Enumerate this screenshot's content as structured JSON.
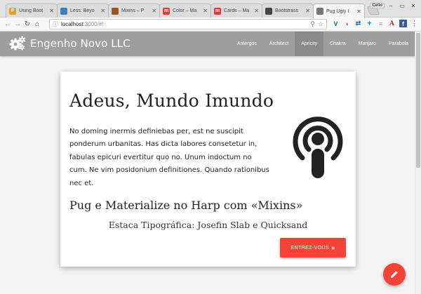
{
  "browser": {
    "tabs": [
      {
        "title": "Using Boot",
        "fav": "P",
        "fav_color": "#f39c12"
      },
      {
        "title": "Less: Beyo",
        "fav": "",
        "fav_color": "#3d7fbf"
      },
      {
        "title": "Mixins – P",
        "fav": "",
        "fav_color": "#a0522d"
      },
      {
        "title": "Color – Ma",
        "fav": "m",
        "fav_color": "#e53935"
      },
      {
        "title": "Cards – Ma",
        "fav": "m",
        "fav_color": "#e53935"
      },
      {
        "title": "Bootstrass",
        "fav": "",
        "fav_color": "#444444"
      },
      {
        "title": "Pug Ugly I",
        "fav": "",
        "fav_color": "#777777"
      }
    ],
    "profile_label": "Celio",
    "address": {
      "host": "localhost",
      "path": ":3000/#!"
    }
  },
  "site": {
    "brand": "Engenho Novo LLC",
    "menu": [
      {
        "label": "Antergos",
        "active": false
      },
      {
        "label": "Architect",
        "active": false
      },
      {
        "label": "Apricity",
        "active": true
      },
      {
        "label": "Chakra",
        "active": false
      },
      {
        "label": "Manjaro",
        "active": false
      },
      {
        "label": "Parabola",
        "active": false
      }
    ],
    "colors": {
      "navbar": "#9e9e9e",
      "accent": "#f44336"
    }
  },
  "card": {
    "title": "Adeus, Mundo Imundo",
    "body": "No doming inermis definiebas per, est ne suscipit ponderum urbanitas. Has dicta labores consetetur in, fabulas epicuri evertitur quo no. Unum indoctum no cum. Ne vim posidonium definitiones. Quando rationibus nec et.",
    "subtitle": "Pug e Materialize no Harp com «Mixins»",
    "tagline": "Estaca Tipográfica: Josefin Slab e Quicksand",
    "button_label": "ENTREZ-VOUS",
    "icon": "podcast-icon"
  },
  "fab": {
    "icon": "pencil-icon"
  }
}
